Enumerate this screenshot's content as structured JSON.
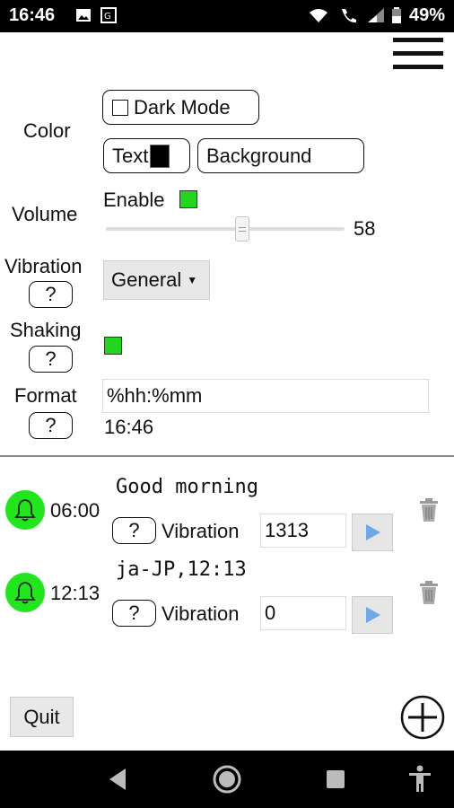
{
  "status_bar": {
    "time": "16:46",
    "battery": "49%",
    "icons": [
      "image-icon",
      "translate-icon",
      "wifi-icon",
      "phone-icon",
      "signal-icon",
      "battery-icon"
    ]
  },
  "color": {
    "label": "Color",
    "dark_mode_label": "Dark Mode",
    "text_label": "Text",
    "text_swatch": "#000000",
    "background_label": "Background",
    "background_swatch": "#ffffff"
  },
  "volume": {
    "label": "Volume",
    "enable_label": "Enable",
    "value": "58",
    "level": 58
  },
  "vibration": {
    "label": "Vibration",
    "help": "?",
    "selected": "General"
  },
  "shaking": {
    "label": "Shaking",
    "help": "?"
  },
  "format": {
    "label": "Format",
    "help": "?",
    "value": "%hh:%mm",
    "preview": "16:46"
  },
  "alarms": [
    {
      "time": "06:00",
      "message": "Good morning",
      "help": "?",
      "vibration_label": "Vibration",
      "vibration_value": "1313"
    },
    {
      "time": "12:13",
      "message": "ja-JP,12:13",
      "help": "?",
      "vibration_label": "Vibration",
      "vibration_value": "0"
    }
  ],
  "footer": {
    "quit_label": "Quit"
  },
  "colors": {
    "accent_green": "#22e61d",
    "play_blue": "#6fa8e8"
  }
}
